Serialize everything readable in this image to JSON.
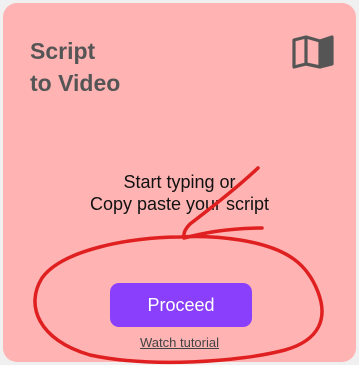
{
  "card": {
    "title_line1": "Script",
    "title_line2": "to Video",
    "icon": "open-book-icon",
    "prompt_line1": "Start typing or",
    "prompt_line2": "Copy paste your script",
    "proceed_label": "Proceed",
    "tutorial_label": "Watch tutorial"
  },
  "colors": {
    "card_background": "#ffb3b3",
    "title_text": "#555555",
    "button_background": "#8a3ffc",
    "button_text": "#ffffff",
    "annotation_stroke": "#e02020"
  }
}
